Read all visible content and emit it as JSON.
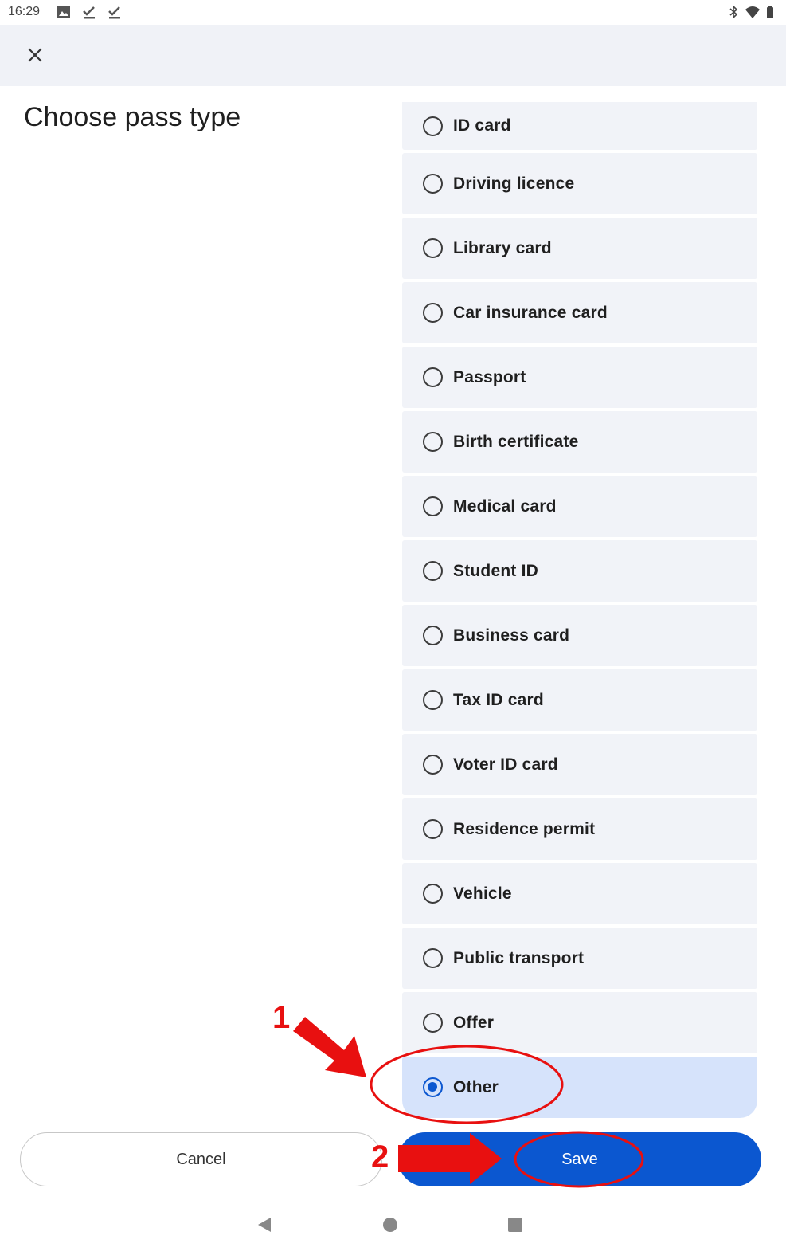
{
  "status_bar": {
    "time": "16:29",
    "left_icons": [
      "image-icon",
      "download-done-icon",
      "download-done-icon"
    ],
    "right_icons": [
      "bluetooth-icon",
      "wifi-icon",
      "battery-icon"
    ]
  },
  "app_bar": {
    "close_icon": "close-icon"
  },
  "page": {
    "title": "Choose pass type"
  },
  "pass_types": [
    {
      "label": "ID card",
      "selected": false
    },
    {
      "label": "Driving licence",
      "selected": false
    },
    {
      "label": "Library card",
      "selected": false
    },
    {
      "label": "Car insurance card",
      "selected": false
    },
    {
      "label": "Passport",
      "selected": false
    },
    {
      "label": "Birth certificate",
      "selected": false
    },
    {
      "label": "Medical card",
      "selected": false
    },
    {
      "label": "Student ID",
      "selected": false
    },
    {
      "label": "Business card",
      "selected": false
    },
    {
      "label": "Tax ID card",
      "selected": false
    },
    {
      "label": "Voter ID card",
      "selected": false
    },
    {
      "label": "Residence permit",
      "selected": false
    },
    {
      "label": "Vehicle",
      "selected": false
    },
    {
      "label": "Public transport",
      "selected": false
    },
    {
      "label": "Offer",
      "selected": false
    },
    {
      "label": "Other",
      "selected": true
    }
  ],
  "actions": {
    "cancel_label": "Cancel",
    "save_label": "Save"
  },
  "annotations": {
    "step1": "1",
    "step2": "2",
    "color": "#e81010"
  },
  "colors": {
    "accent": "#0b57d0",
    "selected_bg": "#d6e3fb",
    "item_bg": "#f1f3f8",
    "app_bar_bg": "#f0f2f7"
  }
}
